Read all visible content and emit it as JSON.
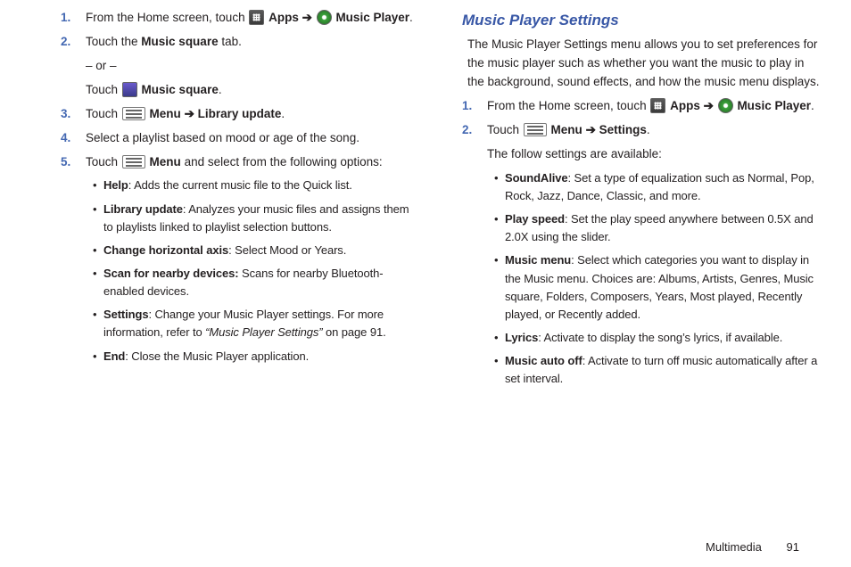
{
  "left": {
    "s1_num": "1.",
    "s1_a": "From the Home screen, touch ",
    "s1_apps": "Apps",
    "s1_arrow": " ➔ ",
    "s1_mp": "Music Player",
    "s1_end": ".",
    "s2_num": "2.",
    "s2_a": "Touch the ",
    "s2_b": "Music square",
    "s2_c": " tab.",
    "s2_or": "– or –",
    "s2_d": "Touch ",
    "s2_e": "Music square",
    "s2_f": ".",
    "s3_num": "3.",
    "s3_a": "Touch ",
    "s3_menu": "Menu",
    "s3_arrow": " ➔ ",
    "s3_lib": "Library update",
    "s3_end": ".",
    "s4_num": "4.",
    "s4_a": "Select a playlist based on mood or age of the song.",
    "s5_num": "5.",
    "s5_a": "Touch ",
    "s5_menu": "Menu",
    "s5_b": " and select from the following options:",
    "b1_t": "Help",
    "b1_d": ": Adds the current music file to the Quick list.",
    "b2_t": "Library update",
    "b2_d": ": Analyzes your music files and assigns them to playlists linked to playlist selection buttons.",
    "b3_t": "Change horizontal axis",
    "b3_d": ": Select Mood or Years.",
    "b4_t": "Scan for nearby devices: ",
    "b4_d": " Scans for nearby Bluetooth-enabled devices.",
    "b5_t": "Settings",
    "b5_d1": ": Change your Music Player settings. For more information, refer to ",
    "b5_link": "“Music Player Settings”",
    "b5_d2": " on page 91.",
    "b6_t": "End",
    "b6_d": ": Close the Music Player application."
  },
  "right": {
    "title": "Music Player Settings",
    "intro": "The Music Player Settings menu allows you to set preferences for the music player such as whether you want the music to play in the background, sound effects, and how the music menu displays.",
    "r1_num": "1.",
    "r1_a": "From the Home screen, touch ",
    "r1_apps": "Apps",
    "r1_arrow": " ➔ ",
    "r1_mp": "Music Player",
    "r1_end": ".",
    "r2_num": "2.",
    "r2_a": "Touch ",
    "r2_menu": "Menu",
    "r2_arrow": " ➔ ",
    "r2_set": "Settings",
    "r2_end": ".",
    "r2_follow": "The follow settings are available:",
    "rb1_t": "SoundAlive",
    "rb1_d": ": Set a type of equalization such as Normal, Pop, Rock, Jazz, Dance, Classic, and more.",
    "rb2_t": "Play speed",
    "rb2_d": ": Set the play speed anywhere between 0.5X and 2.0X using the slider.",
    "rb3_t": "Music menu",
    "rb3_d": ": Select which categories you want to display in the Music menu. Choices are: Albums, Artists, Genres, Music square, Folders, Composers, Years, Most played, Recently played, or Recently added.",
    "rb4_t": "Lyrics",
    "rb4_d": ": Activate to display the song’s lyrics, if available.",
    "rb5_t": "Music auto off",
    "rb5_d": ": Activate to turn off music automatically after a set interval."
  },
  "footer": {
    "section": "Multimedia",
    "page": "91"
  }
}
